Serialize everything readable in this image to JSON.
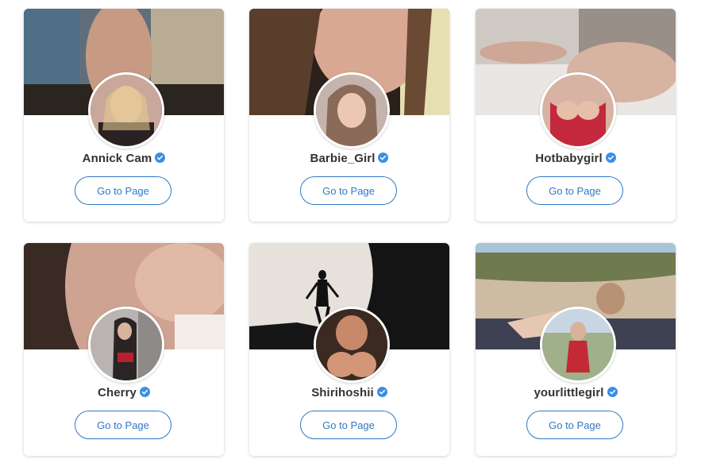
{
  "cards": [
    {
      "name": "Annick Cam",
      "button": "Go to Page"
    },
    {
      "name": "Barbie_Girl",
      "button": "Go to Page"
    },
    {
      "name": "Hotbabygirl",
      "button": "Go to Page"
    },
    {
      "name": "Cherry",
      "button": "Go to Page"
    },
    {
      "name": "Shirihoshii",
      "button": "Go to Page"
    },
    {
      "name": "yourlittlegirl",
      "button": "Go to Page"
    }
  ],
  "colors": {
    "accent": "#2f78c4",
    "verified": "#3b8fe6",
    "name_text": "#333333"
  }
}
